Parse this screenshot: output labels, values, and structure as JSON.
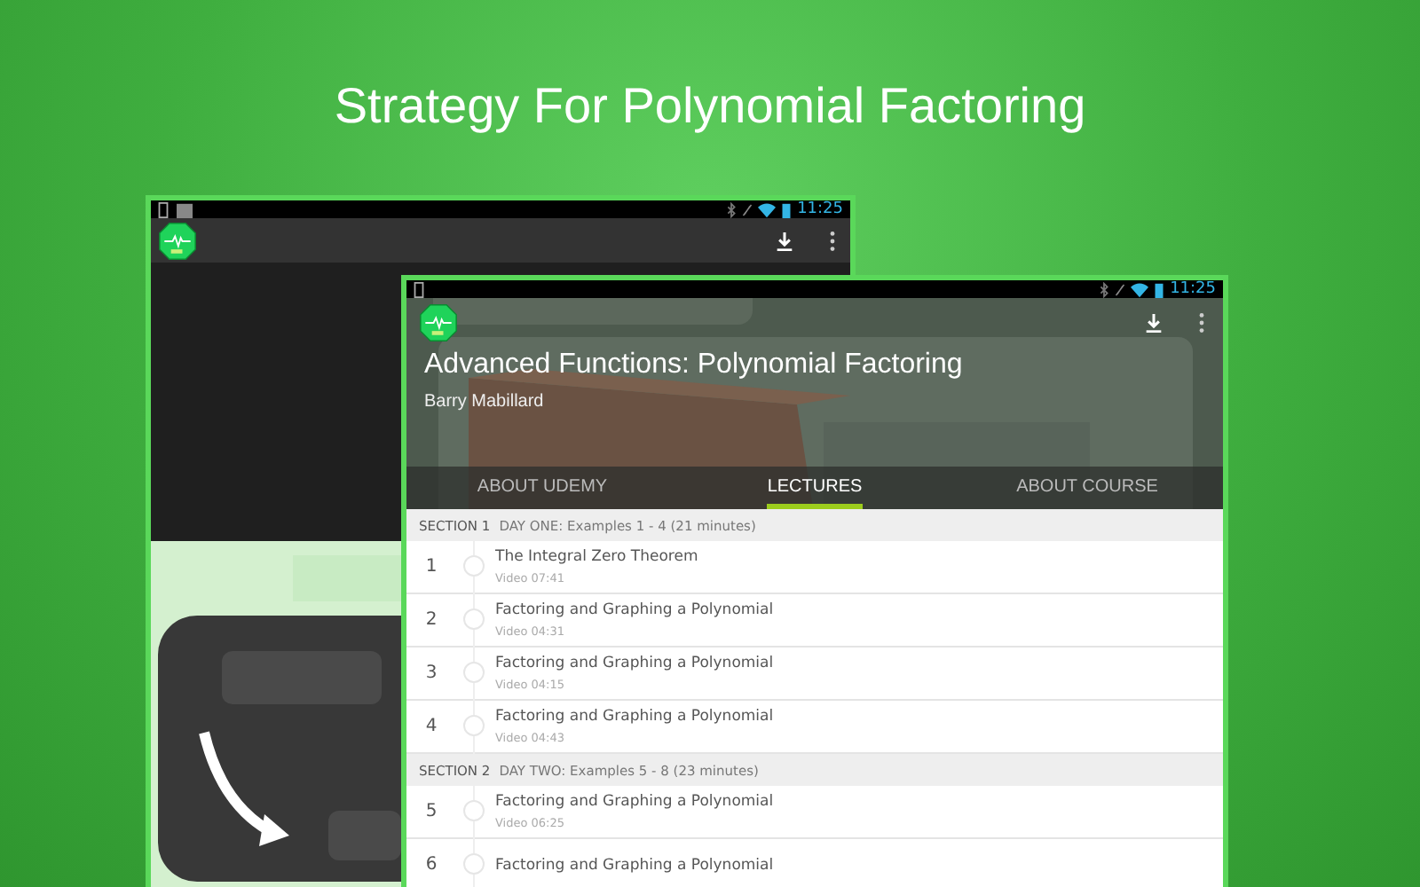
{
  "headline": "Strategy For Polynomial Factoring",
  "back_screen": {
    "status_time": "11:25"
  },
  "front_screen": {
    "status_time": "11:25",
    "course_title": "Advanced Functions: Polynomial Factoring",
    "author": "Barry Mabillard",
    "tabs": [
      {
        "label": "ABOUT UDEMY",
        "selected": false
      },
      {
        "label": "LECTURES",
        "selected": true
      },
      {
        "label": "ABOUT COURSE",
        "selected": false
      }
    ],
    "sections": [
      {
        "label": "SECTION 1",
        "title": "DAY ONE: Examples 1 - 4 (21 minutes)",
        "lectures": [
          {
            "number": "1",
            "title": "The Integral Zero Theorem",
            "meta": "Video 07:41"
          },
          {
            "number": "2",
            "title": "Factoring and Graphing a Polynomial",
            "meta": "Video 04:31"
          },
          {
            "number": "3",
            "title": "Factoring and Graphing a Polynomial",
            "meta": "Video 04:15"
          },
          {
            "number": "4",
            "title": "Factoring and Graphing a Polynomial",
            "meta": "Video 04:43"
          }
        ]
      },
      {
        "label": "SECTION 2",
        "title": "DAY TWO: Examples 5 - 8 (23 minutes)",
        "lectures": [
          {
            "number": "5",
            "title": "Factoring and Graphing a Polynomial",
            "meta": "Video 06:25"
          },
          {
            "number": "6",
            "title": "Factoring and Graphing a Polynomial"
          }
        ]
      }
    ]
  }
}
